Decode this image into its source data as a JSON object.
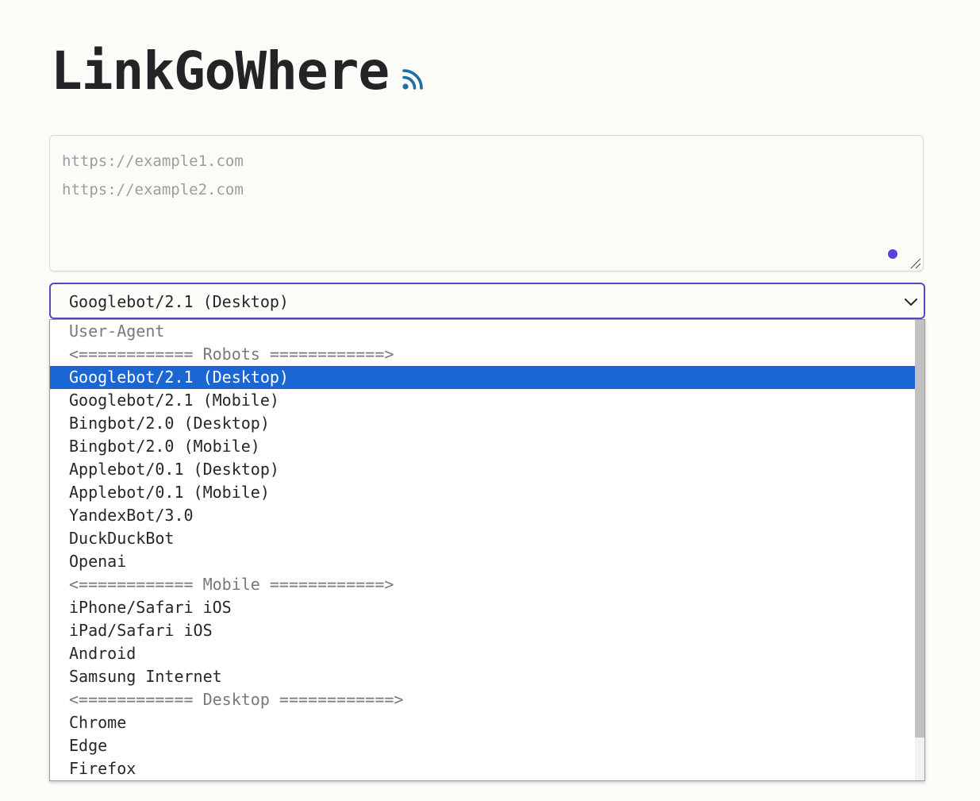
{
  "site": {
    "title": "LinkGoWhere"
  },
  "url_input": {
    "placeholder_lines": [
      "https://example1.com",
      "https://example2.com"
    ]
  },
  "user_agent_select": {
    "selected": "Googlebot/2.1 (Desktop)",
    "options": [
      {
        "label": "User-Agent",
        "muted": true
      },
      {
        "label": "<============ Robots ============>",
        "muted": true
      },
      {
        "label": "Googlebot/2.1 (Desktop)",
        "selected": true
      },
      {
        "label": "Googlebot/2.1 (Mobile)"
      },
      {
        "label": "Bingbot/2.0 (Desktop)"
      },
      {
        "label": "Bingbot/2.0 (Mobile)"
      },
      {
        "label": "Applebot/0.1 (Desktop)"
      },
      {
        "label": "Applebot/0.1 (Mobile)"
      },
      {
        "label": "YandexBot/3.0"
      },
      {
        "label": "DuckDuckBot"
      },
      {
        "label": "Openai"
      },
      {
        "label": "<============ Mobile ============>",
        "muted": true
      },
      {
        "label": "iPhone/Safari iOS"
      },
      {
        "label": "iPad/Safari iOS"
      },
      {
        "label": "Android"
      },
      {
        "label": "Samsung Internet"
      },
      {
        "label": "<============ Desktop ============>",
        "muted": true
      },
      {
        "label": "Chrome"
      },
      {
        "label": "Edge"
      },
      {
        "label": "Firefox"
      }
    ]
  },
  "colors": {
    "accent": "#5a47c6",
    "selection": "#1a66d2",
    "rss": "#1c6ea4",
    "status_dot": "#5a3fd8"
  },
  "icons": {
    "rss": "rss-icon",
    "chevron": "chevron-down-icon"
  }
}
